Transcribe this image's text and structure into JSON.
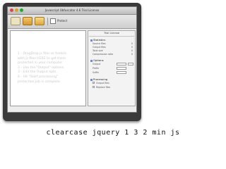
{
  "window": {
    "title": "Javascript Obfuscator 4.6 Trial License"
  },
  "toolbar": {
    "buttons": [
      {
        "name": "new-button",
        "icon": "new-file-icon"
      },
      {
        "name": "open-button",
        "icon": "folder-icon"
      },
      {
        "name": "save-button",
        "icon": "disk-icon"
      }
    ],
    "protect_label": "Protect"
  },
  "editor": {
    "instructions": [
      "1 - DragDrop js files or folders",
      "with js files HERE to get them",
      "protected in your computer",
      "2 - Use the \"Output\" options",
      "3 - Edit the Output opts.",
      "4 - Hit \"Start processing\"",
      "protection job is complete"
    ]
  },
  "sidepanel": {
    "title": "Trial License",
    "statistics_label": "Statistics",
    "stats": [
      {
        "label": "Source files",
        "value": "0"
      },
      {
        "label": "Output files",
        "value": "0"
      },
      {
        "label": "Total size",
        "value": "0"
      },
      {
        "label": "Compression ratio",
        "value": "0"
      }
    ],
    "options_label": "Options",
    "option_rows": [
      {
        "label": "Output"
      },
      {
        "label": "Prefix"
      },
      {
        "label": "Suffix"
      }
    ],
    "processing_label": "Processing",
    "processing_rows": [
      {
        "label": "Output files"
      },
      {
        "label": "Replace files"
      }
    ]
  },
  "caption": "clearcase jquery 1 3 2 min js"
}
